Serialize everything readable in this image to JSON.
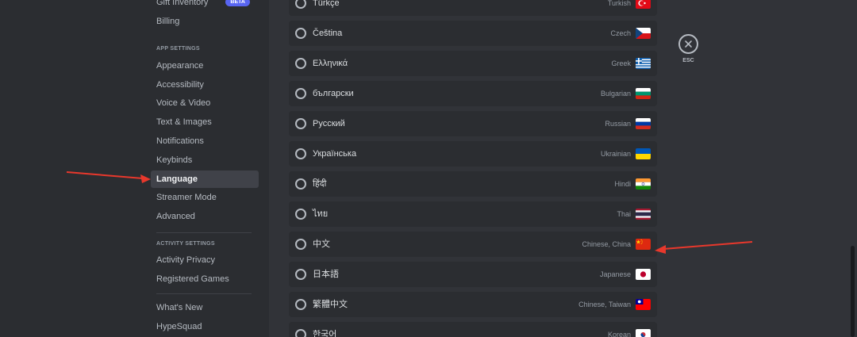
{
  "sidebar": {
    "gift_inventory": "Gift Inventory",
    "beta_badge": "BETA",
    "billing": "Billing",
    "app_settings_header": "APP SETTINGS",
    "app_items": [
      "Appearance",
      "Accessibility",
      "Voice & Video",
      "Text & Images",
      "Notifications",
      "Keybinds",
      "Language",
      "Streamer Mode",
      "Advanced"
    ],
    "activity_settings_header": "ACTIVITY SETTINGS",
    "activity_items": [
      "Activity Privacy",
      "Registered Games"
    ],
    "misc_items": [
      "What's New",
      "HypeSquad"
    ],
    "selected": "Language"
  },
  "languages": [
    {
      "native": "Türkçe",
      "english": "Turkish",
      "flag": "turkey-flag-icon",
      "selected": false
    },
    {
      "native": "Čeština",
      "english": "Czech",
      "flag": "czech-flag-icon",
      "selected": false
    },
    {
      "native": "Ελληνικά",
      "english": "Greek",
      "flag": "greece-flag-icon",
      "selected": false
    },
    {
      "native": "български",
      "english": "Bulgarian",
      "flag": "bulgaria-flag-icon",
      "selected": false
    },
    {
      "native": "Русский",
      "english": "Russian",
      "flag": "russia-flag-icon",
      "selected": false
    },
    {
      "native": "Українська",
      "english": "Ukrainian",
      "flag": "ukraine-flag-icon",
      "selected": false
    },
    {
      "native": "हिंदी",
      "english": "Hindi",
      "flag": "india-flag-icon",
      "selected": false
    },
    {
      "native": "ไทย",
      "english": "Thai",
      "flag": "thailand-flag-icon",
      "selected": false
    },
    {
      "native": "中文",
      "english": "Chinese, China",
      "flag": "china-flag-icon",
      "selected": false
    },
    {
      "native": "日本語",
      "english": "Japanese",
      "flag": "japan-flag-icon",
      "selected": false
    },
    {
      "native": "繁體中文",
      "english": "Chinese, Taiwan",
      "flag": "taiwan-flag-icon",
      "selected": false
    },
    {
      "native": "한국어",
      "english": "Korean",
      "flag": "korea-flag-icon",
      "selected": false
    }
  ],
  "close": {
    "icon": "close-icon",
    "label": "ESC"
  },
  "colors": {
    "background": "#313338",
    "sidebar": "#2b2d31",
    "selected_nav": "#404249",
    "accent": "#5865f2",
    "annotation_arrow": "#e8382c"
  }
}
